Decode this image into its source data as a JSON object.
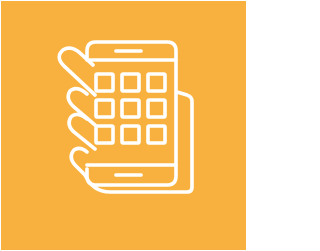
{
  "icon": {
    "name": "hand-holding-smartphone-icon",
    "background_color": "#F8B13E",
    "stroke_color": "#FFFFFF",
    "app_grid": {
      "rows": 3,
      "columns": 3
    }
  }
}
